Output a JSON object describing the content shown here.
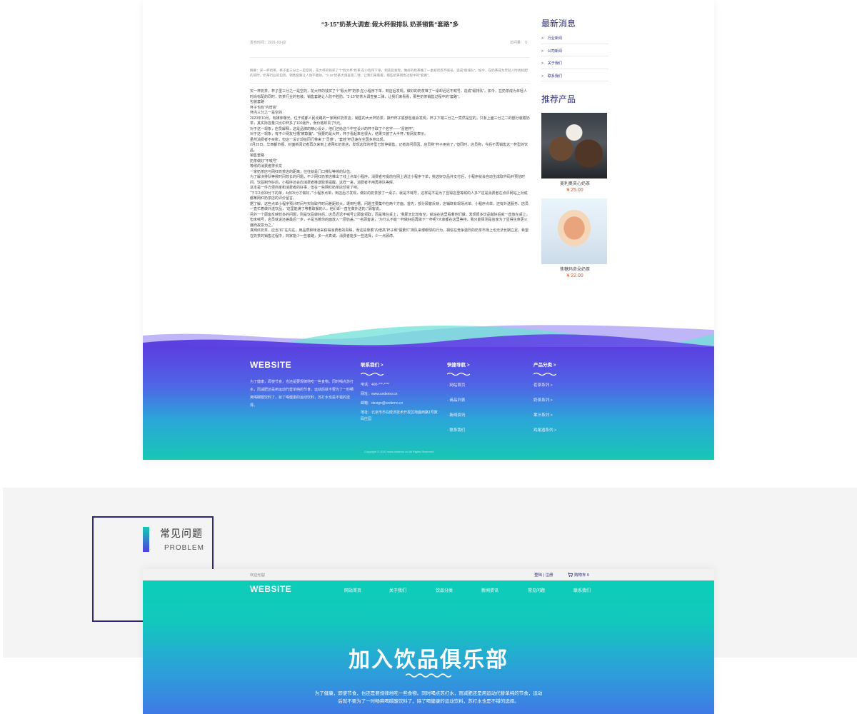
{
  "article": {
    "title": "“3·15”奶茶大调查:假大杯假排队 奶茶销售“套路”多",
    "date": "发布时间：2021-03-02",
    "views": "访问量： 0",
    "summary": "摘要：买一杯奶茶，杯子里三分之一是空的，花大杯的钱买了个“假大杯”奶茶;在小程序下单，到店后发现，做好的奶茶堆了一桌却迟迟不喊号，造成“假排队”。如今，在奶茶成为年轻人时尚标配的同时，奶茶行业的包装、销售套路让人防不胜防。“3·15”奶茶大调查第二弹，让我们来看看，那些奶茶销售过程中的“套路”。",
    "body": [
      "买一杯奶茶，杯子里三分之一是空的，花大杯的钱买了个“假大杯”奶茶;在小程序下单，到店后发现，做好的奶茶堆了一桌却迟迟不喊号，造成“假排队”。如今，在奶茶成为年轻人时尚标配的同时，奶茶行业的包装、销售套路让人防不胜防。“3·15”奶茶大调查第二弹，让我们来看看，那些奶茶销售过程中的“套路”。",
      "包装套路",
      "杯子也有“内增高”",
      "杯内三分之一是空的",
      "2020年10月，有媒体曝光，位于成都人民北路的一家网红奶茶店，销售的大大杯奶茶，撕开杯子底部包装会发现，杯子下端三分之一竟然是空的，只有上面三分之二的部分装着奶茶，其实际容量只比中杯多了100毫升，而价格却贵了5元。",
      "对于这一现象，店员解释，这是品牌的精心设计，他们还给这个中空设计的杯子取了个名字——“喜娃杯”。",
      "对于这一现象，有不少网友吐槽“被欺骗”，“我要的是大杯，杯子看起来也很大，结果只装了大半杯，”有网友表示。",
      "虽然消费者不买账，但这一设计却给同行带来了“灵感”，“套娃”杯迅速在全国多地出现。",
      "2月25日，华西都市报、封面新闻记者再次来到上述网红奶茶店，发现这样的杯型已暂停销售，记者询问原因，店员称“杯子用完了，”但同时，店员称，今后不再销售这一杯型的饮品。",
      "销售套路",
      "奶茶做好“不喊号”",
      "等候的消费者排长龙",
      "一家奶茶店与网红奶茶店的距离，往往就是门口排队等候的队伍。",
      "为了解决排队等候时间较长的问题，不少网红奶茶店推出了线上点单小程序。消费者可提前在网上通过小程序下单，挑选好饮品并支付后，小程序就会自动生成取件码并预估时间。饮品制作好后，小程序还会向消费者推送取茶提醒。这样一来，消费者不用再排队等候。",
      "这本是一件方便商家和消费者的好事，但在一些网红奶茶店却变了味。",
      "“下午2点09分下的单，4点05分才做好，”“小程序点单，到店后才发现，做好的奶茶放了一桌子，就是不喊号，这样是不是为了显得店里等候的人多?”这是消费者在点评网站上对成都某网红奶茶店的评价留言。",
      "据了解，这些点单小程序预计时间与实际取件时间差距较大，遭到吐槽，问题主要集中在两个方面。首先，部分顾客反映，店铺既有现场点单、小程序点单，还有外送服务，店员一直忙着做外送饮品，“这里能满了等着取餐的人，他们却一直在做外送的。”顾客说。",
      "另外一个顾客反映较多的问题，则是饮品做好后，店员迟迟不喊号让顾客领取，而是堆在桌上，“我那天比较有空，就站在店里看着他们做，发现很多饮品做好后就一直放在桌上，但未喊号，店员就说还差最后一步，子是当着你的面放入一层奶盖。”一名顾客说，“为什么不能一杯做好后再做下一杯呢?大家都在这里等待，我只能猜测是店家为了显得生意更火爆而故意为之。”",
      "真网红奶茶，应当“红”在内在，用品质和味道来获得消费者的青睐，而这些靠着“内增高”杯子和“假繁忙”排队来博眼球的行为，相信在竞争激烈的奶茶市场上也无法长期立足，希望在奶茶的销售过程中，商家能少一些套路，多一点真诚，消费者能多一些选择，少一点顾虑。"
    ]
  },
  "sidebar": {
    "news_title": "最新消息",
    "news": [
      "行业新闻",
      "公司新闻",
      "关于我们",
      "联系我们"
    ],
    "news_marker": ">",
    "products_title": "推荐产品",
    "products": [
      {
        "name": "美利奥夹心奶茶",
        "price": "¥ 25.00"
      },
      {
        "name": "焦糖玛奇朵奶茶",
        "price": "¥ 22.00"
      }
    ]
  },
  "footer": {
    "logo": "WEBSITE",
    "desc": "为了健康，即使节食，也还是要规律地吃一些食物。同时喝点苏打水，而减肥还是用运动代替单纯的节食，运动后就不要为了一时畅爽喝碳酸饮料了，就了喝健康的运动饮料，苏打水也是不错的选择。",
    "contact": {
      "title": "联系我们  >",
      "lines": [
        "电话：400-***-****",
        "网址：www.cedemo.cn",
        "邮箱：design@cedemo.cn",
        "地址：北京市市在经济技术开发区地盛西路1号数码庄园"
      ]
    },
    "quicknav": {
      "title": "快捷导航  >",
      "items": [
        "· 网站首页",
        "· 商品列表",
        "· 新闻资讯",
        "· 联系我们"
      ]
    },
    "category": {
      "title": "产品分类  >",
      "items": [
        "茗茶系列 >",
        "奶茶系列 >",
        "果汁系列 >",
        "鸡尾酒系列 >"
      ]
    },
    "copyright": "Copyright © 2021  www.cedemo.cn  All Rights Reserved"
  },
  "faq": {
    "title_cn": "常见问题",
    "title_en": "PROBLEM"
  },
  "bottom": {
    "welcome": "欢迎光临!",
    "login": "登陆 | 注册",
    "cart": "购物车  0",
    "logo": "WEBSITE",
    "nav": [
      "网站首页",
      "关于我们",
      "饮品分类",
      "新闻资讯",
      "常见问题",
      "联系我们"
    ],
    "hero_title": "加入饮品俱乐部",
    "hero_desc": "为了健康，即使节食，也还是要规律地吃一些食物。同时喝点苏打水，而减肥还是用运动代替单纯的节食，运动后就不要为了一时畅爽喝碳酸饮料了，除了喝健康的运动饮料，苏打水也是不错的选择。"
  },
  "colors": {
    "brand_navy": "#2d2d7a",
    "price_red": "#e84c1e",
    "gradient_purple": "#5b3fe0",
    "gradient_teal": "#18c7b3"
  },
  "icons": {
    "cart": "cart-icon",
    "squiggle": "wave-squiggle-icon"
  }
}
